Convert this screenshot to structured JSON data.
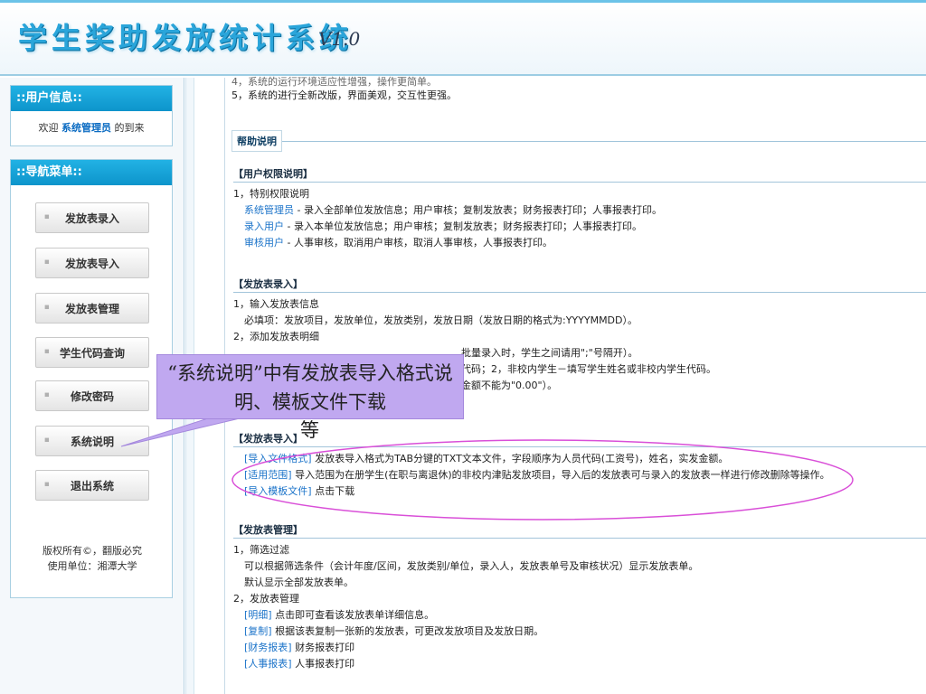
{
  "app": {
    "title": "学生奖助发放统计系统",
    "version": "V1.0"
  },
  "sidebar": {
    "user_panel_title": "::用户信息::",
    "welcome_prefix": "欢迎",
    "welcome_user": "系统管理员",
    "welcome_suffix": "的到来",
    "nav_panel_title": "::导航菜单::",
    "nav": [
      "发放表录入",
      "发放表导入",
      "发放表管理",
      "学生代码查询",
      "修改密码",
      "系统说明",
      "退出系统"
    ],
    "footer": [
      "版权所有©，翻版必究",
      "使用单位：湘潭大学"
    ]
  },
  "main": {
    "top_partial": "4，系统的运行环境适应性增强，操作更简单。",
    "top_item5": "5，系统的进行全新改版，界面美观，交互性更强。",
    "help_tag": "帮助说明",
    "permissions": {
      "title": "【用户权限说明】",
      "l1": "1，特别权限说明",
      "roles": [
        {
          "name": "系统管理员",
          "desc": " - 录入全部单位发放信息；用户审核；复制发放表；财务报表打印；人事报表打印。"
        },
        {
          "name": "录入用户",
          "desc": " - 录入本单位发放信息；用户审核；复制发放表；财务报表打印；人事报表打印。"
        },
        {
          "name": "审核用户",
          "desc": " - 人事审核，取消用户审核，取消人事审核，人事报表打印。"
        }
      ]
    },
    "entry": {
      "title": "【发放表录入】",
      "l1": "1，输入发放表信息",
      "l2": "必填项：发放项目，发放单位，发放类别，发放日期（发放日期的格式为:YYYYMMDD）。",
      "l3": "2，添加发放表明细",
      "l4": "批量录入时，学生之间请用\";\"号隔开）。",
      "l5": "代码；2，非校内学生－填写学生姓名或非校内学生代码。",
      "l6": "金额不能为\"0.00\"）。"
    },
    "import": {
      "title": "【发放表导入】",
      "items": [
        {
          "tag": "[导入文件格式]",
          "desc": " 发放表导入格式为TAB分键的TXT文本文件，字段顺序为人员代码(工资号)，姓名，实发金额。"
        },
        {
          "tag": "[适用范围]",
          "desc": " 导入范围为在册学生(在职与离退休)的非校内津贴发放项目，导入后的发放表可与录入的发放表一样进行修改删除等操作。"
        },
        {
          "tag": "[导入模板文件]",
          "desc": " 点击下载"
        }
      ]
    },
    "manage": {
      "title": "【发放表管理】",
      "l1": "1，筛选过滤",
      "l2": "可以根据筛选条件（会计年度/区间，发放类别/单位，录入人，发放表单号及审核状况）显示发放表单。",
      "l3": "默认显示全部发放表单。",
      "l4": "2，发放表管理",
      "items": [
        {
          "tag": "[明细]",
          "desc": " 点击即可查看该发放表单详细信息。"
        },
        {
          "tag": "[复制]",
          "desc": " 根据该表复制一张新的发放表，可更改发放项目及发放日期。"
        },
        {
          "tag": "[财务报表]",
          "desc": " 财务报表打印"
        },
        {
          "tag": "[人事报表]",
          "desc": " 人事报表打印"
        }
      ]
    }
  },
  "callout": {
    "text": "“系统说明”中有发放表导入格式说明、模板文件下载",
    "tail": "等"
  },
  "colors": {
    "accent": "#1b73c9",
    "panel_header": "#0d94cb",
    "callout": "#c0a8f0",
    "ellipse": "#d94fd8"
  }
}
